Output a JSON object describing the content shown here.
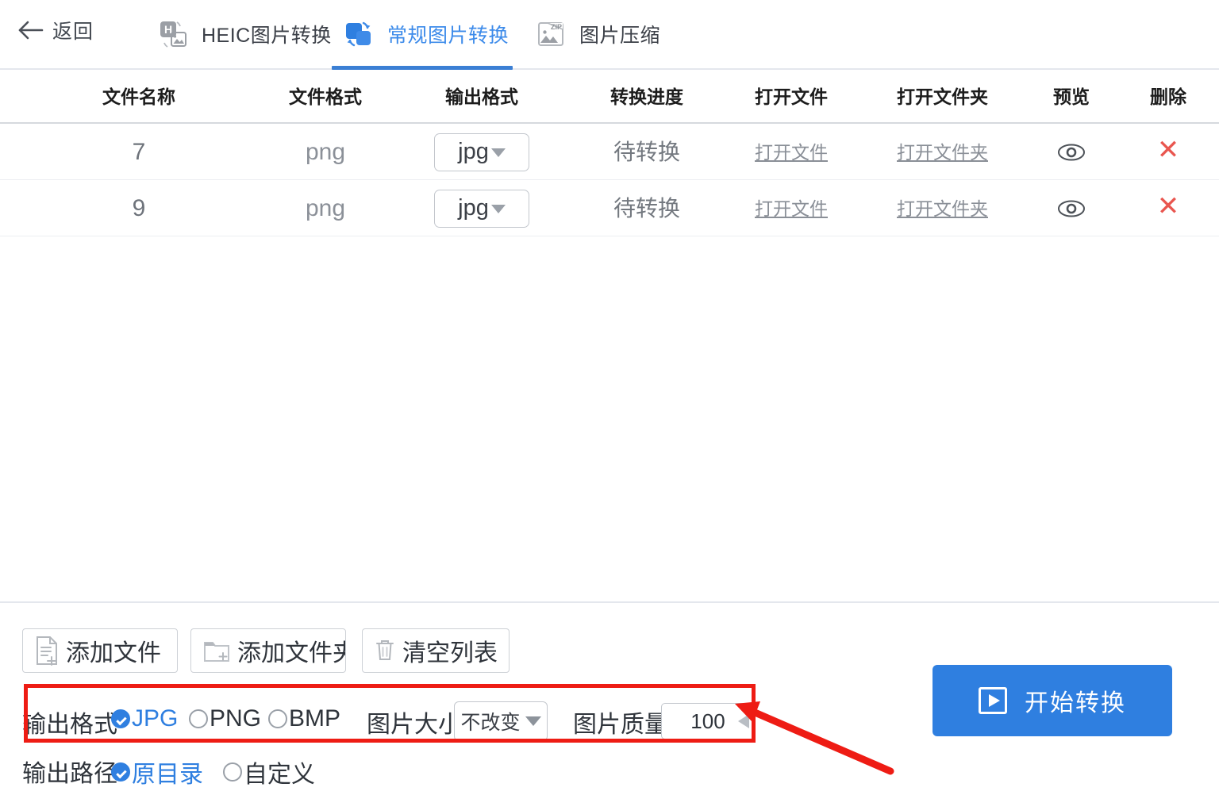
{
  "header": {
    "back_label": "返回",
    "back_icon": "arrow-left-icon",
    "tabs": [
      {
        "label": "HEIC图片转换",
        "icon": "heic-convert-icon",
        "active": false
      },
      {
        "label": "常规图片转换",
        "icon": "image-convert-icon",
        "active": true
      },
      {
        "label": "图片压缩",
        "icon": "zip-compress-icon",
        "active": false
      }
    ],
    "active_tab_color": "#3d8bea"
  },
  "table": {
    "columns": [
      "文件名称",
      "文件格式",
      "输出格式",
      "转换进度",
      "打开文件",
      "打开文件夹",
      "预览",
      "删除"
    ],
    "rows": [
      {
        "name": "7",
        "format": "png",
        "output_format": "jpg",
        "progress": "待转换",
        "open_file": "打开文件",
        "open_folder": "打开文件夹",
        "preview_icon": "eye-icon",
        "delete_icon": "close-x-icon"
      },
      {
        "name": "9",
        "format": "png",
        "output_format": "jpg",
        "progress": "待转换",
        "open_file": "打开文件",
        "open_folder": "打开文件夹",
        "preview_icon": "eye-icon",
        "delete_icon": "close-x-icon"
      }
    ]
  },
  "toolbar": {
    "add_file": "添加文件",
    "add_folder": "添加文件夹",
    "clear_list": "清空列表",
    "add_file_icon": "file-plus-icon",
    "add_folder_icon": "folder-plus-icon",
    "clear_list_icon": "trash-icon"
  },
  "options": {
    "output_format_label": "输出格式",
    "formats": [
      {
        "label": "JPG",
        "selected": true
      },
      {
        "label": "PNG",
        "selected": false
      },
      {
        "label": "BMP",
        "selected": false
      }
    ],
    "image_size_label": "图片大小",
    "image_size_value": "不改变",
    "image_quality_label": "图片质量",
    "image_quality_value": "100",
    "output_path_label": "输出路径",
    "paths": [
      {
        "label": "原目录",
        "selected": true
      },
      {
        "label": "自定义",
        "selected": false
      }
    ]
  },
  "actions": {
    "start_label": "开始转换",
    "start_icon": "play-icon",
    "start_color": "#2f7fe0"
  },
  "annotations": {
    "highlight_color": "#ee1c14",
    "box_target": "output-options-row",
    "arrow_target": "image-quality-input"
  }
}
